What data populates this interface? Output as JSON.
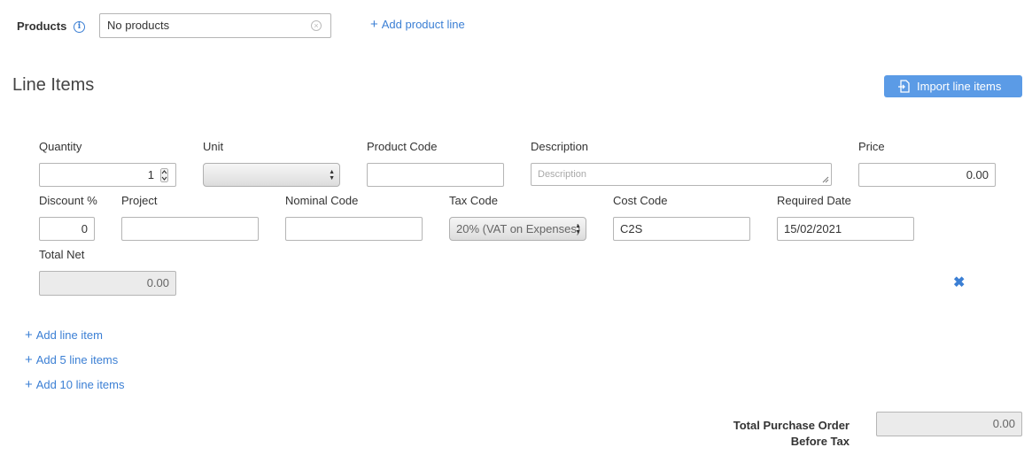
{
  "products": {
    "label": "Products",
    "info_icon": "info-icon",
    "select_value": "No products",
    "clear_icon": "clear-circle-icon",
    "add_product_line": "Add product line"
  },
  "line_items": {
    "title": "Line Items",
    "import_button": "Import line items",
    "import_icon": "import-file-icon",
    "fields": {
      "quantity": {
        "label": "Quantity",
        "value": "1"
      },
      "unit": {
        "label": "Unit",
        "value": ""
      },
      "product_code": {
        "label": "Product Code",
        "value": ""
      },
      "description": {
        "label": "Description",
        "placeholder": "Description",
        "value": ""
      },
      "price": {
        "label": "Price",
        "value": "0.00"
      },
      "discount": {
        "label": "Discount %",
        "value": "0"
      },
      "project": {
        "label": "Project",
        "value": ""
      },
      "nominal_code": {
        "label": "Nominal Code",
        "value": ""
      },
      "tax_code": {
        "label": "Tax Code",
        "value": "20% (VAT on Expenses)"
      },
      "cost_code": {
        "label": "Cost Code",
        "value": "C2S"
      },
      "required_date": {
        "label": "Required Date",
        "value": "15/02/2021"
      },
      "total_net": {
        "label": "Total Net",
        "value": "0.00"
      }
    },
    "remove_icon": "remove-x-icon",
    "add_links": {
      "add_one": "Add line item",
      "add_five": "Add 5 line items",
      "add_ten": "Add 10 line items"
    }
  },
  "totals": {
    "label_line1": "Total Purchase Order",
    "label_line2": "Before Tax",
    "value": "0.00"
  },
  "colors": {
    "accent": "#3b7fd4",
    "button": "#5b9be6",
    "disabled_bg": "#ebebeb"
  }
}
